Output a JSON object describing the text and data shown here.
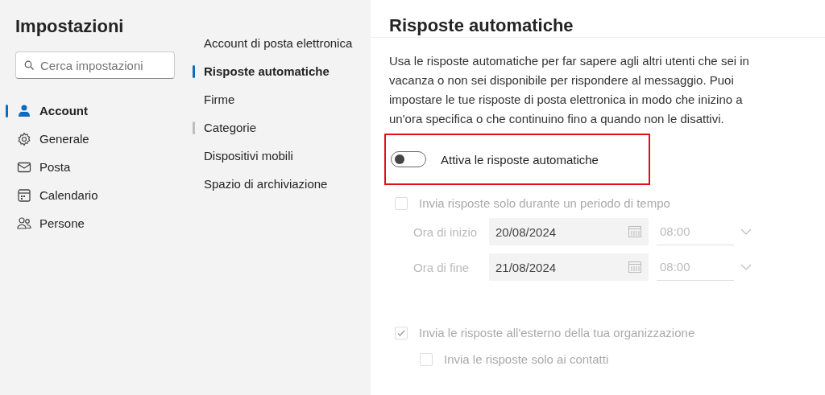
{
  "sidebar": {
    "title": "Impostazioni",
    "search": {
      "placeholder": "Cerca impostazioni"
    },
    "items": [
      {
        "label": "Account",
        "kind": "person",
        "selected": true
      },
      {
        "label": "Generale",
        "kind": "gear",
        "selected": false
      },
      {
        "label": "Posta",
        "kind": "mail",
        "selected": false
      },
      {
        "label": "Calendario",
        "kind": "calendar",
        "selected": false
      },
      {
        "label": "Persone",
        "kind": "people",
        "selected": false
      }
    ]
  },
  "subnav": {
    "items": [
      {
        "label": "Account di posta elettronica",
        "selected": false,
        "hovered": false
      },
      {
        "label": "Risposte automatiche",
        "selected": true,
        "hovered": false
      },
      {
        "label": "Firme",
        "selected": false,
        "hovered": false
      },
      {
        "label": "Categorie",
        "selected": false,
        "hovered": true
      },
      {
        "label": "Dispositivi mobili",
        "selected": false,
        "hovered": false
      },
      {
        "label": "Spazio di archiviazione",
        "selected": false,
        "hovered": false
      }
    ]
  },
  "panel": {
    "title": "Risposte automatiche",
    "description": "Usa le risposte automatiche per far sapere agli altri utenti che sei in vacanza o non sei disponibile per rispondere al messaggio. Puoi impostare le tue risposte di posta elettronica in modo che inizino a un'ora specifica o che continuino fino a quando non le disattivi.",
    "toggle": {
      "label": "Attiva le risposte automatiche",
      "on": false,
      "highlighted": true
    },
    "period": {
      "label": "Invia risposte solo durante un periodo di tempo",
      "checked": false,
      "disabled": true
    },
    "times": [
      {
        "label": "Ora di inizio",
        "date": "20/08/2024",
        "time": "08:00"
      },
      {
        "label": "Ora di fine",
        "date": "21/08/2024",
        "time": "08:00"
      }
    ],
    "external": {
      "label": "Invia le risposte all'esterno della tua organizzazione",
      "checked": true,
      "disabled": true
    },
    "contacts_only": {
      "label": "Invia le risposte solo ai contatti",
      "checked": false,
      "disabled": true
    }
  }
}
